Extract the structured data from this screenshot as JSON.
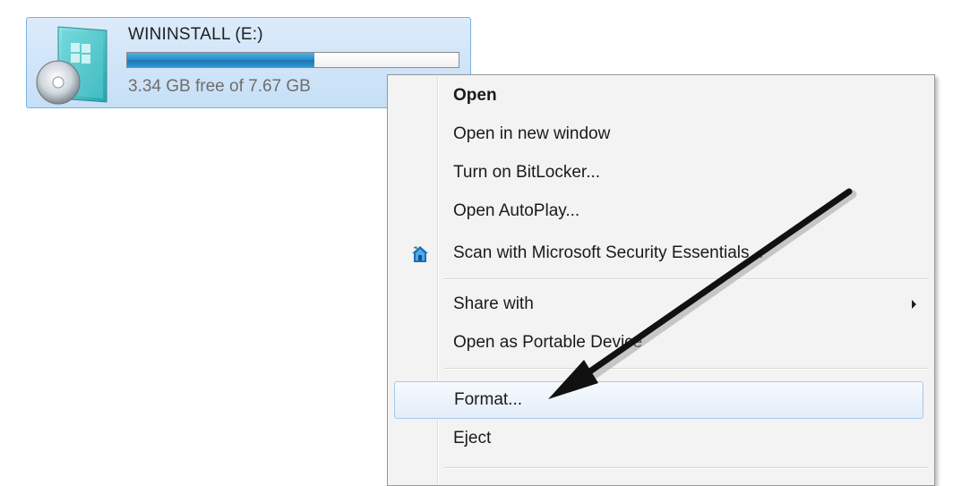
{
  "drive": {
    "name": "WININSTALL (E:)",
    "free_text": "3.34 GB free of 7.67 GB",
    "used_fraction": 0.565,
    "icon": "windows-install-disc-icon"
  },
  "context_menu": {
    "items": [
      {
        "label": "Open",
        "bold": true
      },
      {
        "label": "Open in new window"
      },
      {
        "label": "Turn on BitLocker..."
      },
      {
        "label": "Open AutoPlay..."
      },
      {
        "label": "Scan with Microsoft Security Essentials...",
        "icon": "security-essentials-icon"
      },
      {
        "label": "Share with",
        "submenu": true
      },
      {
        "label": "Open as Portable Device"
      },
      {
        "label": "Format...",
        "highlighted": true
      },
      {
        "label": "Eject"
      }
    ]
  },
  "annotation": {
    "type": "black-arrow",
    "points_to": "Format..."
  },
  "colors": {
    "selection_fill": "#c6dff6",
    "selection_border": "#7ab3e3",
    "menu_background": "#f3f3f3",
    "bar_fill": "#2a8fca"
  }
}
